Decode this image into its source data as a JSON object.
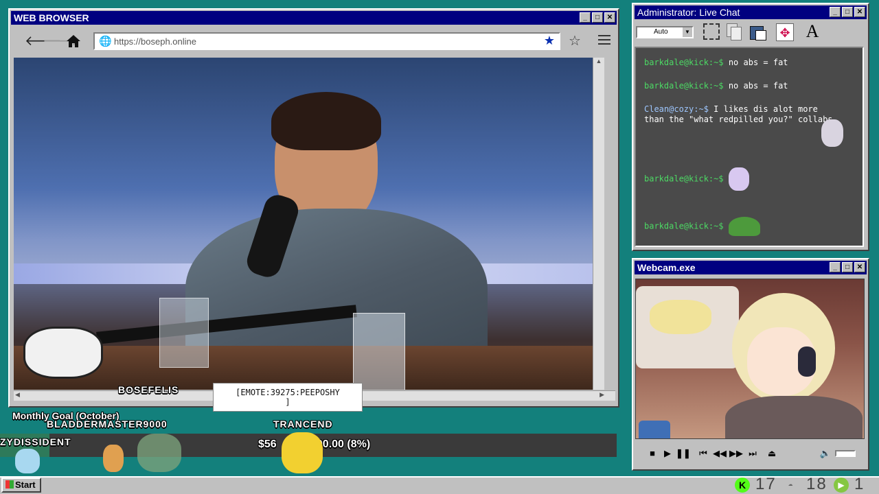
{
  "browser": {
    "title": "WEB BROWSER",
    "url": "https://boseph.online",
    "video_description": "Livestream video of man laughing at microphone in studio"
  },
  "chat": {
    "title": "Administrator: Live Chat",
    "font_select": "Auto",
    "messages": [
      {
        "user": "barkdale@kick:~$",
        "text": "no abs = fat"
      },
      {
        "user": "barkdale@kick:~$",
        "text": "no abs = fat"
      },
      {
        "user": "Clean@cozy:~$",
        "text": "I likes dis alot more than the \"what redpilled you?\" collabs"
      },
      {
        "user": "barkdale@kick:~$",
        "text": ""
      },
      {
        "user": "barkdale@kick:~$",
        "text": ""
      }
    ]
  },
  "webcam": {
    "title": "Webcam.exe"
  },
  "overlay": {
    "name_bosefelis": "BOSEFELIS",
    "tooltip": "[EMOTE:39275:PEEPOSHY",
    "tooltip_bracket": "]",
    "goal_label": "Monthly Goal (October)",
    "name_bladder": "BLADDERMASTER9000",
    "name_trancend": "TRANCEND",
    "name_zydissident": "ZYDISSIDENT",
    "goal_amount_left": "$56",
    "goal_amount_right": "700.00 (8%)",
    "goal_progress": 0.08
  },
  "taskbar": {
    "start_label": "Start",
    "count_a": "17",
    "count_b": "18",
    "count_c": "1"
  },
  "colors": {
    "desktop": "#13807c",
    "titlebar": "#000080",
    "chat_user": "#4cd964"
  }
}
